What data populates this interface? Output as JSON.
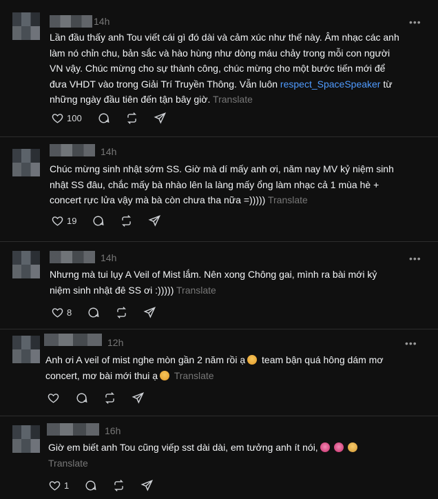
{
  "posts": [
    {
      "time": "14h",
      "lines": [
        "Lần đầu thấy anh Tou viết cái gì đó dài và cảm xúc như thế này. Âm nhạc các anh",
        "làm nó chỉn chu, bản sắc và hào hùng như dòng máu chảy trong mỗi con người",
        "VN vậy. Chúc mừng cho sự thành công, chúc mừng cho một bước tiến mới để",
        "đưa VHDT vào trong Giải Trí Truyền Thông. Vẫn luôn "
      ],
      "link": "respect_SpaceSpeaker",
      "after_link": " từ",
      "last_line": "những ngày đầu tiên đến tận bây giờ.",
      "translate": "Translate",
      "likes": "100"
    },
    {
      "time": "14h",
      "lines": [
        "Chúc mừng sinh nhật sớm SS. Giờ mà dí mấy anh ơi, năm nay MV kỷ niệm sinh",
        "nhật SS đâu, chắc mấy bà nhào lên la làng mấy ổng làm nhạc cả 1 mùa hè +",
        "concert rực lửa vậy mà bà còn chưa tha nữa =)))))"
      ],
      "translate": "Translate",
      "likes": "19"
    },
    {
      "time": "14h",
      "lines": [
        "Nhưng mà tui lụy A Veil of Mist lắm. Nên xong Chông gai, mình ra bài mới kỷ",
        "niệm sinh nhật đê SS ơi :)))))"
      ],
      "translate": "Translate",
      "likes": "8"
    },
    {
      "time": "12h",
      "line1": "Anh ơi A veil of mist nghe mòn gần 2 năm rồi ạ",
      "line1b": " team bận quá hông dám mơ",
      "line2": "concert, mơ bài mới thui ạ",
      "translate": "Translate"
    },
    {
      "time": "16h",
      "line1": "Giờ em biết anh Tou cũng viếp sst dài dài, em tưởng anh ít nói,",
      "translate": "Translate",
      "likes": "1"
    }
  ],
  "icons": [
    "heart-icon",
    "comment-icon",
    "repost-icon",
    "share-icon",
    "more-icon"
  ],
  "more_label": "•••"
}
